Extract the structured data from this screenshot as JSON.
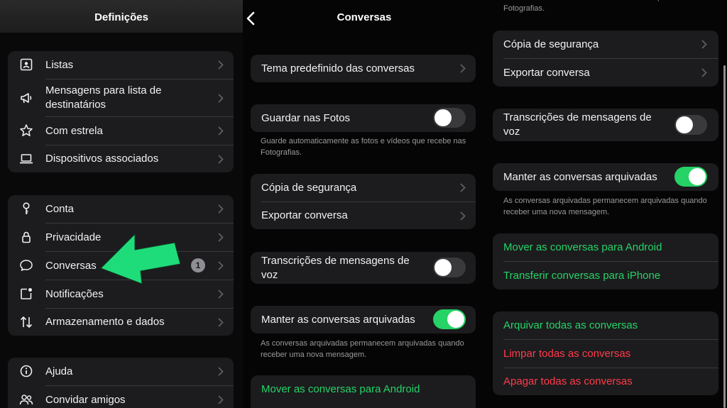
{
  "panel1": {
    "title": "Definições",
    "group1": [
      {
        "label": "Listas",
        "icon": "list-card-icon"
      },
      {
        "label": "Mensagens para lista de destinatários",
        "icon": "megaphone-icon"
      },
      {
        "label": "Com estrela",
        "icon": "star-icon"
      },
      {
        "label": "Dispositivos associados",
        "icon": "laptop-icon"
      }
    ],
    "group2": [
      {
        "label": "Conta",
        "icon": "key-icon"
      },
      {
        "label": "Privacidade",
        "icon": "lock-icon"
      },
      {
        "label": "Conversas",
        "icon": "chat-bubble-icon",
        "badge": "1"
      },
      {
        "label": "Notificações",
        "icon": "notification-icon"
      },
      {
        "label": "Armazenamento e dados",
        "icon": "data-arrows-icon"
      }
    ],
    "group3": [
      {
        "label": "Ajuda",
        "icon": "info-icon"
      },
      {
        "label": "Convidar amigos",
        "icon": "people-icon"
      }
    ],
    "annotation": {
      "icon": "green-arrow-icon",
      "color": "#1fdc7a"
    }
  },
  "panel2": {
    "title": "Conversas",
    "theme_label": "Tema predefinido das conversas",
    "save_photos_label": "Guardar nas Fotos",
    "save_photos_on": false,
    "save_photos_note": "Guarde automaticamente as fotos e vídeos que recebe nas Fotografias.",
    "backup_label": "Cópia de segurança",
    "export_label": "Exportar conversa",
    "transcripts_label": "Transcrições de mensagens de voz",
    "transcripts_on": false,
    "keep_archived_label": "Manter as conversas arquivadas",
    "keep_archived_on": true,
    "keep_archived_note": "As conversas arquivadas permanecem arquivadas quando receber uma nova mensagem.",
    "move_android_label": "Mover as conversas para Android"
  },
  "panel3": {
    "top_note": "Guarde automaticamente as fotos e vídeos que recebe nas Fotografias.",
    "backup_label": "Cópia de segurança",
    "export_label": "Exportar conversa",
    "transcripts_label": "Transcrições de mensagens de voz",
    "transcripts_on": false,
    "keep_archived_label": "Manter as conversas arquivadas",
    "keep_archived_on": true,
    "keep_archived_note": "As conversas arquivadas permanecem arquivadas quando receber uma nova mensagem.",
    "move_android_label": "Mover as conversas para Android",
    "transfer_iphone_label": "Transferir conversas para iPhone",
    "archive_all_label": "Arquivar todas as conversas",
    "clear_all_label": "Limpar todas as conversas",
    "delete_all_label": "Apagar todas as conversas"
  },
  "colors": {
    "accent_green": "#25d366",
    "danger_red": "#ff3b4a",
    "cell_bg": "#1c1c1e"
  }
}
